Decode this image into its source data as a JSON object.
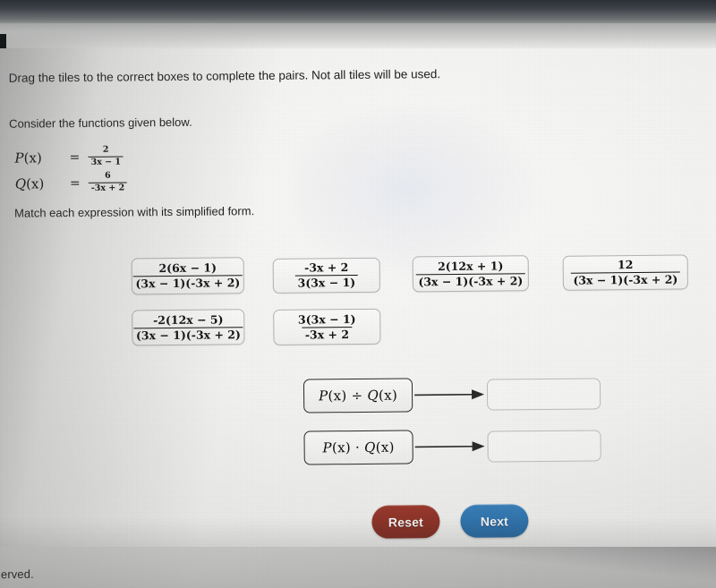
{
  "instructions": {
    "prompt": "Drag the tiles to the correct boxes to complete the pairs. Not all tiles will be used.",
    "consider": "Consider the functions given below.",
    "match": "Match each expression with its simplified form."
  },
  "functions": [
    {
      "name": "P",
      "arg": "(x)",
      "equals": "=",
      "numerator": "2",
      "denominator": "3x − 1"
    },
    {
      "name": "Q",
      "arg": "(x)",
      "equals": "=",
      "numerator": "6",
      "denominator": "-3x + 2"
    }
  ],
  "tiles": [
    {
      "id": "tile-1",
      "numerator": "2(6x − 1)",
      "denominator": "(3x − 1)(-3x + 2)"
    },
    {
      "id": "tile-2",
      "numerator": "-3x + 2",
      "denominator": "3(3x − 1)"
    },
    {
      "id": "tile-3",
      "numerator": "2(12x + 1)",
      "denominator": "(3x − 1)(-3x + 2)"
    },
    {
      "id": "tile-4",
      "numerator": "12",
      "denominator": "(3x − 1)(-3x + 2)"
    },
    {
      "id": "tile-5",
      "numerator": "-2(12x − 5)",
      "denominator": "(3x − 1)(-3x + 2)"
    },
    {
      "id": "tile-6",
      "numerator": "3(3x − 1)",
      "denominator": "-3x + 2"
    }
  ],
  "pairs": [
    {
      "id": "pair-divide",
      "left": "P",
      "left_arg": "(x)",
      "operator": "÷",
      "right": "Q",
      "right_arg": "(x)",
      "answer": ""
    },
    {
      "id": "pair-multiply",
      "left": "P",
      "left_arg": "(x)",
      "operator": "·",
      "right": "Q",
      "right_arg": "(x)",
      "answer": ""
    }
  ],
  "buttons": {
    "reset": "Reset",
    "next": "Next"
  },
  "footer": {
    "text": "erved."
  },
  "colors": {
    "reset_button": "#8b3327",
    "next_button": "#2f72ab",
    "tile_border": "#b4b4b2",
    "expr_border": "#2a2a2a",
    "text": "#1d1d1d"
  }
}
